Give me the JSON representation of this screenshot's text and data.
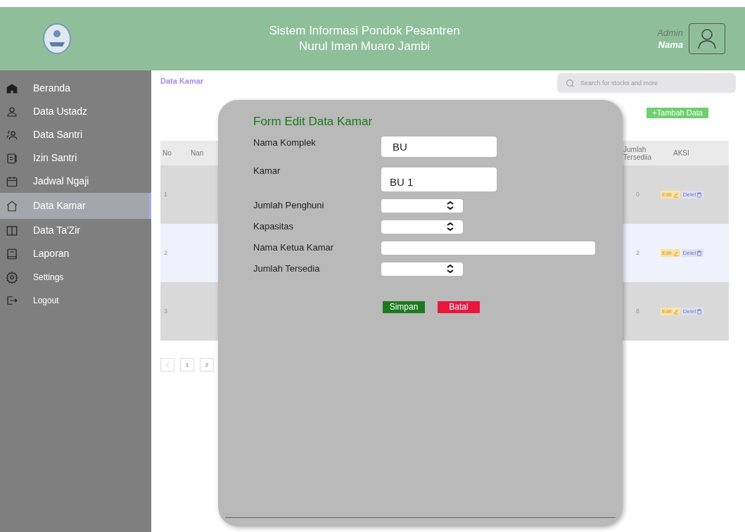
{
  "header": {
    "title_lines": [
      "Sistem Informasi Pondok Pesantren",
      "Nurul Iman Muaro Jambi"
    ],
    "user": {
      "role": "Admin",
      "name": "Nama"
    }
  },
  "sidebar": {
    "items": [
      {
        "label": "Beranda",
        "kind": "main",
        "selected": false
      },
      {
        "label": "Data Ustadz",
        "kind": "main",
        "selected": false
      },
      {
        "label": "Data Santri",
        "kind": "main",
        "selected": false
      },
      {
        "label": "Izin Santri",
        "kind": "main",
        "selected": false
      },
      {
        "label": "Jadwal Ngaji",
        "kind": "main",
        "selected": false
      },
      {
        "label": "Data Kamar",
        "kind": "main",
        "selected": true
      },
      {
        "label": "Data Ta'Zir",
        "kind": "main",
        "selected": false
      },
      {
        "label": "Laporan",
        "kind": "main",
        "selected": false
      },
      {
        "label": "Settings",
        "kind": "small",
        "selected": false
      },
      {
        "label": "Logout",
        "kind": "small",
        "selected": false
      }
    ]
  },
  "breadcrumb": "Data Kamar",
  "search": {
    "placeholder": "Search for stocks and more"
  },
  "add_button": "+Tambah Data",
  "table": {
    "columns": [
      "No",
      "Nan",
      "Jumlah Tersediia",
      "AKSI"
    ],
    "rows": [
      {
        "no": "1",
        "tersedia": "0",
        "selected": false,
        "actions": [
          "Edit",
          "Delet"
        ]
      },
      {
        "no": "2",
        "tersedia": "2",
        "selected": true,
        "actions": [
          "Edit",
          "Delet"
        ]
      },
      {
        "no": "3",
        "tersedia": "8",
        "selected": false,
        "actions": [
          "Edit",
          "Delet"
        ]
      }
    ]
  },
  "pagination": {
    "pages": [
      "1",
      "2"
    ]
  },
  "modal": {
    "title": "Form Edit Data Kamar",
    "fields": [
      {
        "label": "Nama Komplek",
        "kind": "text",
        "value": "BU"
      },
      {
        "label": "Kamar",
        "kind": "tall",
        "value": "BU 1"
      },
      {
        "label": "Jumlah Penghuni",
        "kind": "number"
      },
      {
        "label": "Kapasitas",
        "kind": "number"
      },
      {
        "label": "Nama Ketua Kamar",
        "kind": "wide"
      },
      {
        "label": "Jumlah Tersedia",
        "kind": "number"
      }
    ],
    "buttons": [
      {
        "label": "Simpan",
        "kind": "save"
      },
      {
        "label": "Batal",
        "kind": "cancel"
      }
    ]
  }
}
